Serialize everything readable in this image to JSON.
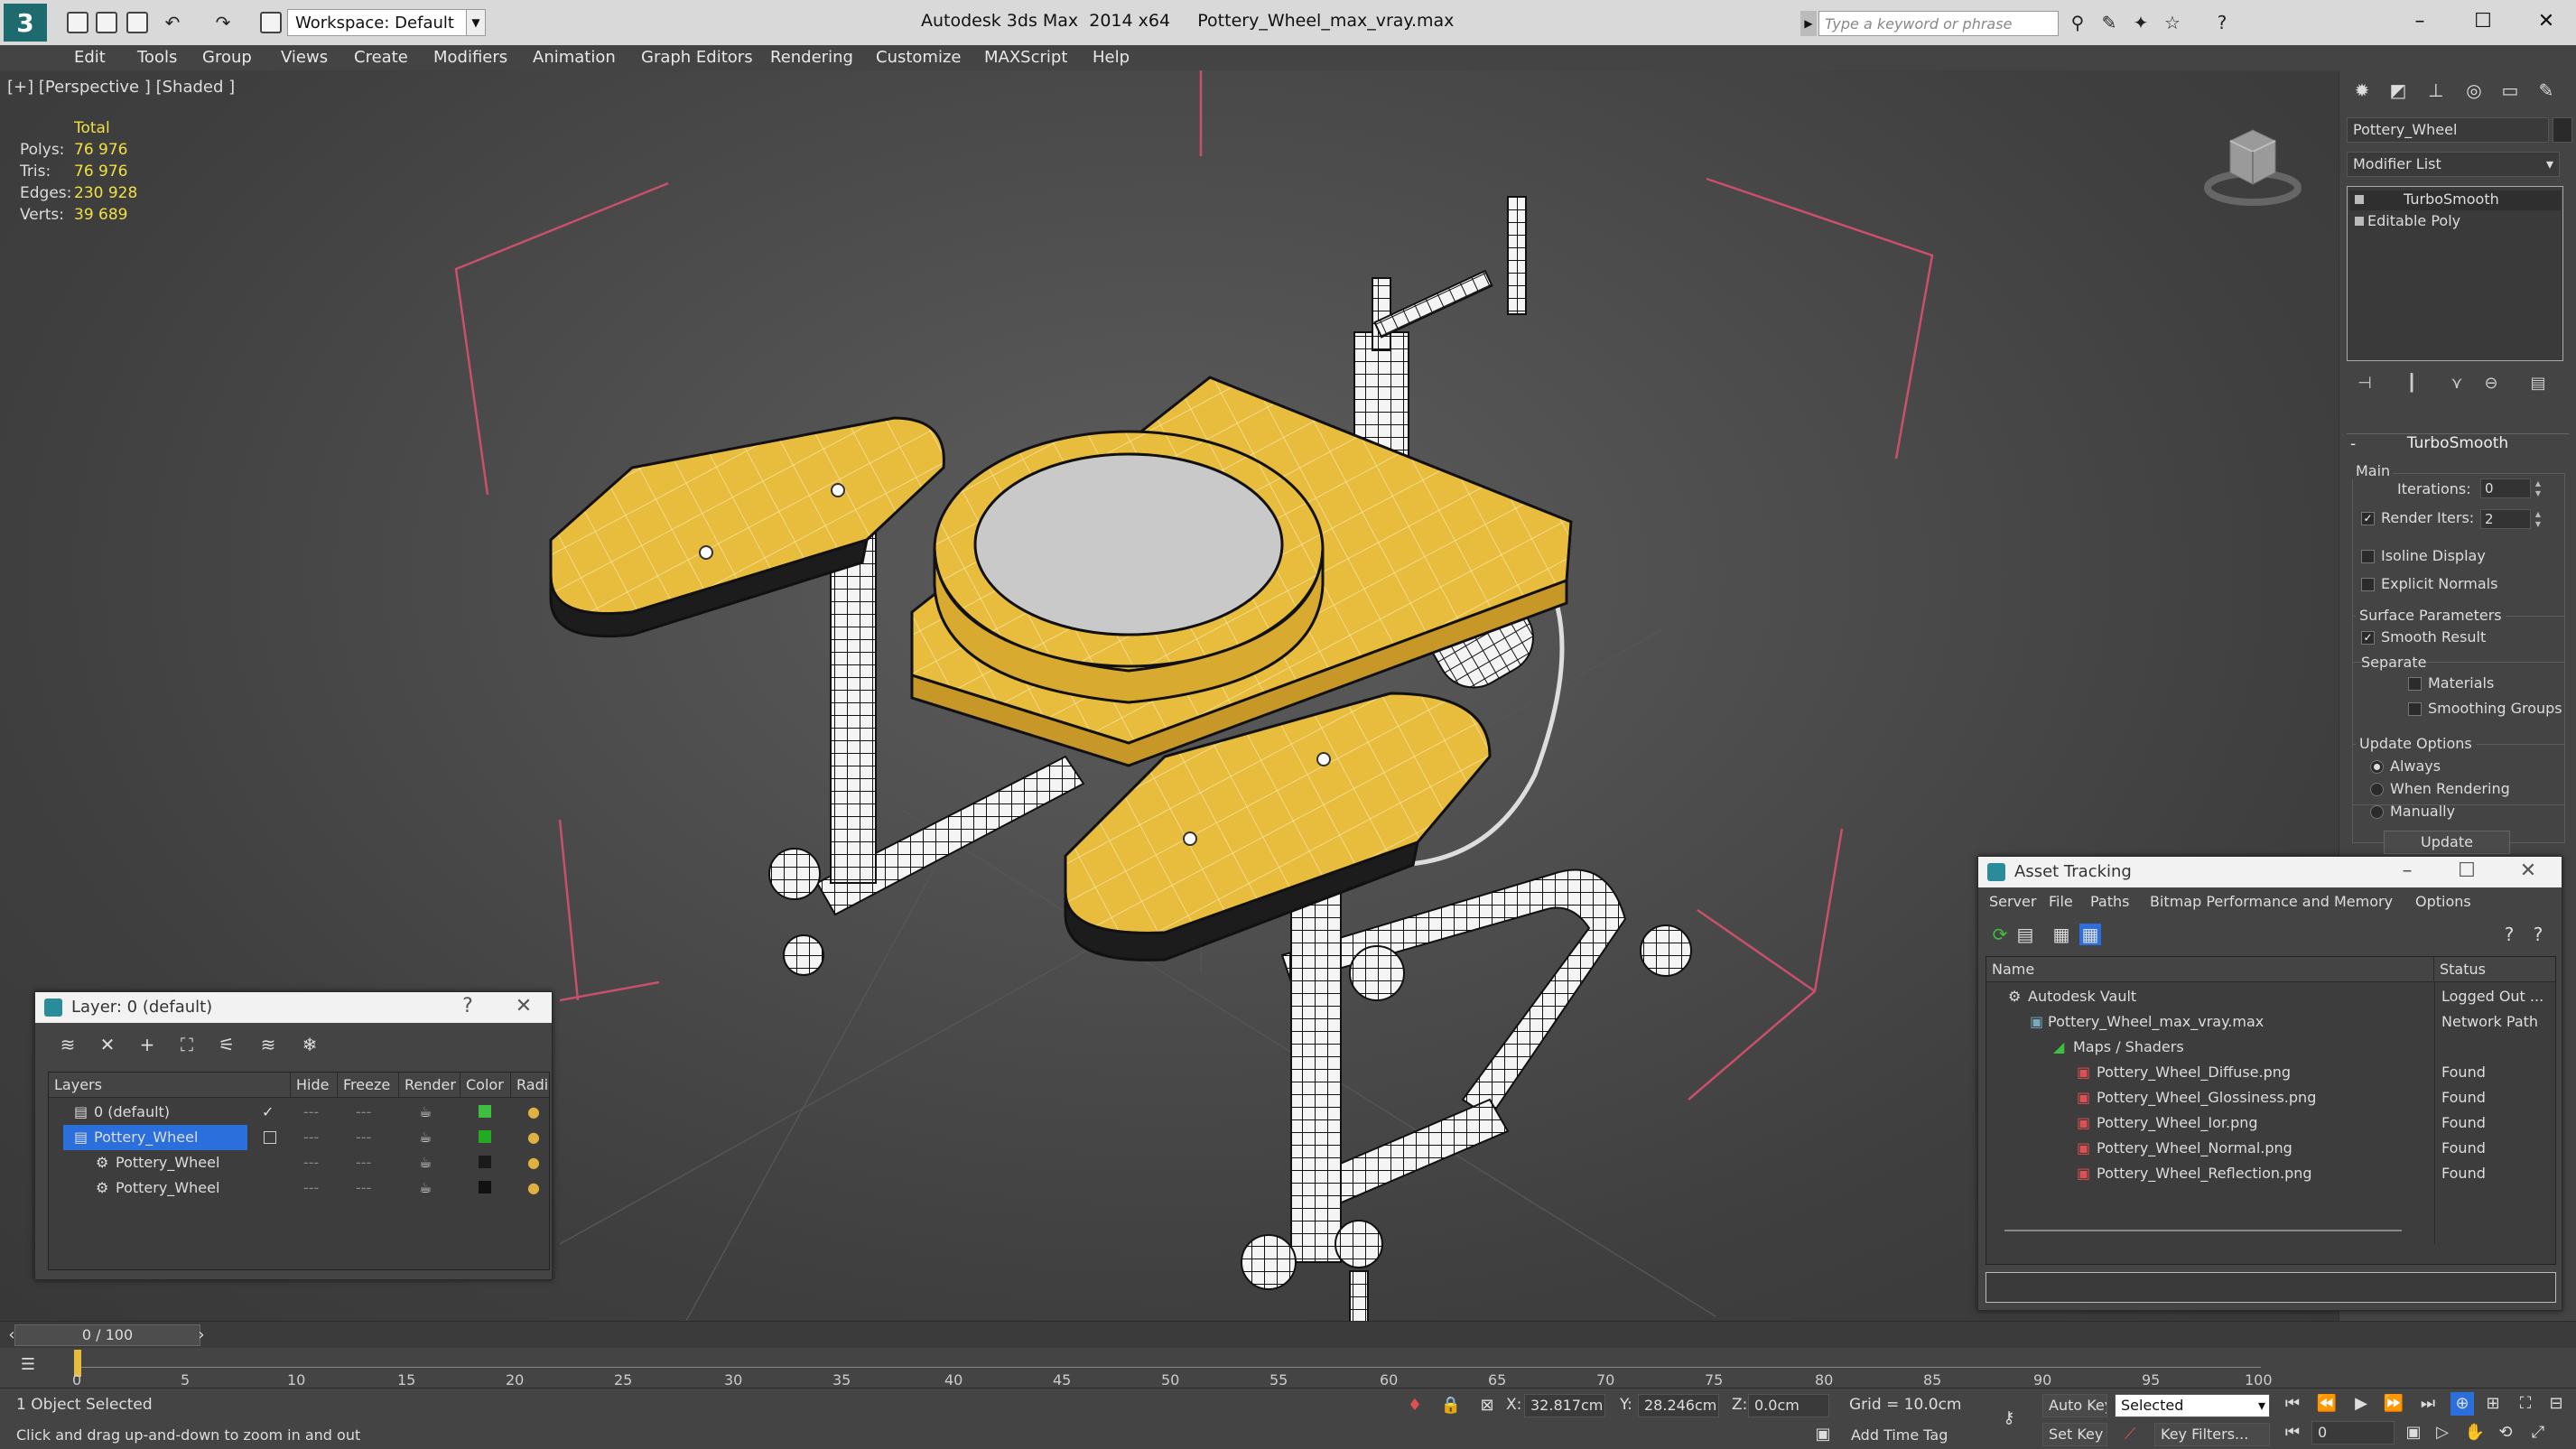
{
  "titlebar": {
    "workspace": "Workspace: Default",
    "app_title": "Autodesk 3ds Max  2014 x64",
    "file_title": "Pottery_Wheel_max_vray.max",
    "search_placeholder": "Type a keyword or phrase"
  },
  "menu": [
    "Edit",
    "Tools",
    "Group",
    "Views",
    "Create",
    "Modifiers",
    "Animation",
    "Graph Editors",
    "Rendering",
    "Customize",
    "MAXScript",
    "Help"
  ],
  "viewport": {
    "label": "[+] [Perspective ] [Shaded ]",
    "stats": {
      "header": "Total",
      "rows": [
        {
          "k": "Polys:",
          "v": "76 976"
        },
        {
          "k": "Tris:",
          "v": "76 976"
        },
        {
          "k": "Edges:",
          "v": "230 928"
        },
        {
          "k": "Verts:",
          "v": "39 689"
        }
      ]
    }
  },
  "command_panel": {
    "object_name": "Pottery_Wheel",
    "modifier_list": "Modifier List",
    "stack": [
      "TurboSmooth",
      "Editable Poly"
    ],
    "rollout": "TurboSmooth",
    "main_group": "Main",
    "iterations_label": "Iterations:",
    "iterations_value": "0",
    "render_iters_label": "Render Iters:",
    "render_iters_value": "2",
    "isoline": "Isoline Display",
    "explicit_normals": "Explicit Normals",
    "surface_group": "Surface Parameters",
    "smooth_result": "Smooth Result",
    "separate": "Separate",
    "materials": "Materials",
    "smoothing_groups": "Smoothing Groups",
    "update_group": "Update Options",
    "always": "Always",
    "when_rendering": "When Rendering",
    "manually": "Manually",
    "update_button": "Update"
  },
  "layer_window": {
    "title": "Layer: 0 (default)",
    "help": "?",
    "columns": [
      "Layers",
      "Hide",
      "Freeze",
      "Render",
      "Color",
      "Radio"
    ],
    "rows": [
      {
        "name": "0 (default)",
        "color": "#3fbf3f"
      },
      {
        "name": "Pottery_Wheel",
        "color": "#22aa22"
      },
      {
        "name": "Pottery_Wheel",
        "color": "#1a1a1a"
      },
      {
        "name": "Pottery_Wheel",
        "color": "#111111"
      }
    ]
  },
  "asset_window": {
    "title": "Asset Tracking",
    "menu": [
      "Server",
      "File",
      "Paths",
      "Bitmap Performance and Memory",
      "Options"
    ],
    "columns": [
      "Name",
      "Status"
    ],
    "rows": [
      {
        "name": "Autodesk Vault",
        "status": "Logged Out ..."
      },
      {
        "name": "Pottery_Wheel_max_vray.max",
        "status": "Network Path"
      },
      {
        "name": "Maps / Shaders",
        "status": ""
      },
      {
        "name": "Pottery_Wheel_Diffuse.png",
        "status": "Found"
      },
      {
        "name": "Pottery_Wheel_Glossiness.png",
        "status": "Found"
      },
      {
        "name": "Pottery_Wheel_Ior.png",
        "status": "Found"
      },
      {
        "name": "Pottery_Wheel_Normal.png",
        "status": "Found"
      },
      {
        "name": "Pottery_Wheel_Reflection.png",
        "status": "Found"
      }
    ]
  },
  "timeline": {
    "frame": "0 / 100",
    "ticks": [
      "0",
      "5",
      "10",
      "15",
      "20",
      "25",
      "30",
      "35",
      "40",
      "45",
      "50",
      "55",
      "60",
      "65",
      "70",
      "75",
      "80",
      "85",
      "90",
      "95",
      "100"
    ]
  },
  "status": {
    "selection": "1 Object Selected",
    "prompt": "Click and drag up-and-down to zoom in and out",
    "x_label": "X:",
    "x_value": "32.817cm",
    "y_label": "Y:",
    "y_value": "28.246cm",
    "z_label": "Z:",
    "z_value": "0.0cm",
    "grid": "Grid = 10.0cm",
    "auto_key": "Auto Key",
    "selected": "Selected",
    "set_key": "Set Key",
    "key_filters": "Key Filters...",
    "add_time_tag": "Add Time Tag",
    "frame_field": "0"
  },
  "colors": {
    "wood": "#e8bc3c",
    "wire": "#1a1a1a",
    "selection": "#2a6fdc",
    "stat_value": "#f0e040"
  }
}
